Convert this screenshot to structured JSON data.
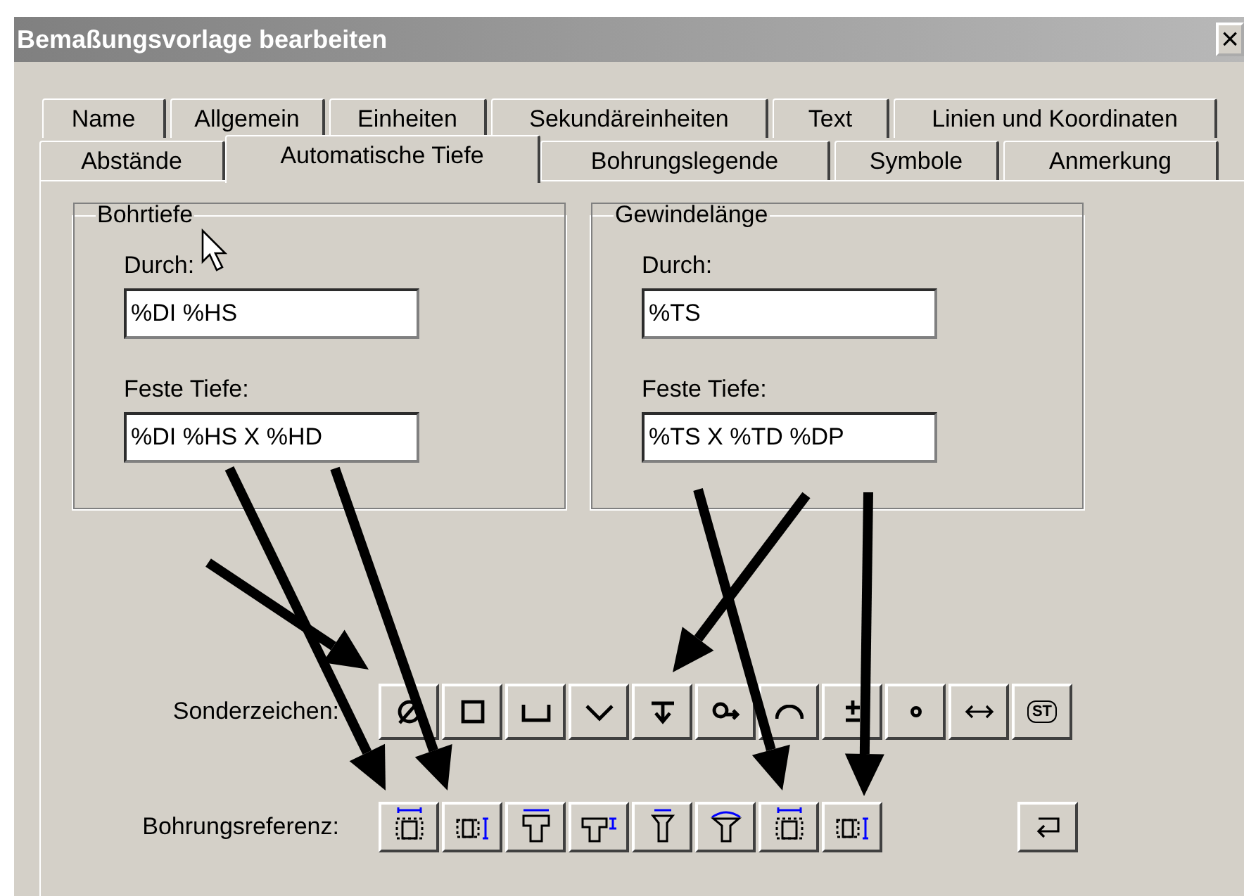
{
  "window": {
    "title": "Bemaßungsvorlage bearbeiten",
    "close": "×"
  },
  "tab_rows": [
    [
      {
        "label": "Name",
        "selected": false
      },
      {
        "label": "Allgemein",
        "selected": false
      },
      {
        "label": "Einheiten",
        "selected": false
      },
      {
        "label": "Sekundäreinheiten",
        "selected": false
      },
      {
        "label": "Text",
        "selected": false
      },
      {
        "label": "Linien und Koordinaten",
        "selected": false
      }
    ],
    [
      {
        "label": "Abstände",
        "selected": false
      },
      {
        "label": "Automatische Tiefe",
        "selected": true
      },
      {
        "label": "Bohrungslegende",
        "selected": false
      },
      {
        "label": "Symbole",
        "selected": false
      },
      {
        "label": "Anmerkung",
        "selected": false
      }
    ]
  ],
  "groups": [
    {
      "title": "Bohrtiefe",
      "fields": [
        {
          "label": "Durch:",
          "value": "%DI %HS"
        },
        {
          "label": "Feste Tiefe:",
          "value": "%DI %HS X %HD"
        }
      ]
    },
    {
      "title": "Gewindelänge",
      "fields": [
        {
          "label": "Durch:",
          "value": "%TS"
        },
        {
          "label": "Feste Tiefe:",
          "value": "%TS X %TD %DP"
        }
      ]
    }
  ],
  "special_chars": {
    "label": "Sonderzeichen:",
    "buttons": [
      {
        "kind": "diameter"
      },
      {
        "kind": "square"
      },
      {
        "kind": "counterbore"
      },
      {
        "kind": "countersink"
      },
      {
        "kind": "depth"
      },
      {
        "kind": "ring-arrow"
      },
      {
        "kind": "arc"
      },
      {
        "kind": "plus-minus"
      },
      {
        "kind": "degree"
      },
      {
        "kind": "double-arrow"
      },
      {
        "kind": "statistical",
        "glyph": "ST"
      }
    ]
  },
  "hole_refs": {
    "label": "Bohrungsreferenz:",
    "buttons": [
      {
        "kind": "hole-width"
      },
      {
        "kind": "hole-depth"
      },
      {
        "kind": "cbore-width"
      },
      {
        "kind": "cbore-depth"
      },
      {
        "kind": "csink-width"
      },
      {
        "kind": "csink-angle"
      },
      {
        "kind": "thread-width"
      },
      {
        "kind": "thread-depth"
      }
    ],
    "extra": {
      "kind": "return"
    }
  }
}
